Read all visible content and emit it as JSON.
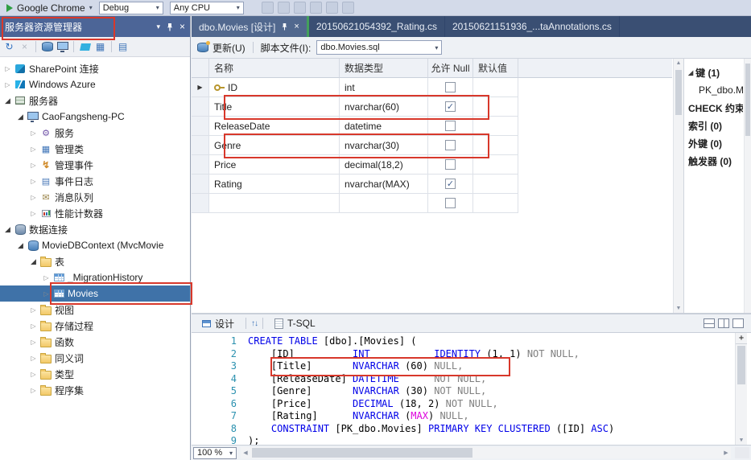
{
  "icons": {
    "play": "▶",
    "dropdown": "▾",
    "close": "×",
    "refresh": "↻",
    "collapsed": "▷",
    "expanded": "◢",
    "check": "✓",
    "swap": "↑↓",
    "scroll_left": "◀",
    "scroll_right": "▶",
    "scroll_up": "▲",
    "scroll_down": "▼",
    "current_row": "▶",
    "splitter_grip": "+"
  },
  "top_toolbar": {
    "run_target": "Google Chrome",
    "configuration": "Debug",
    "platform": "Any CPU"
  },
  "server_explorer": {
    "title": "服务器资源管理器",
    "toolbar_icons": [
      {
        "name": "refresh-icon",
        "type": "glyph",
        "glyph": "↻",
        "color": "#2e6fc0"
      },
      {
        "name": "stop-refresh-icon",
        "type": "glyph",
        "glyph": "×",
        "color": "#b3b8c2"
      },
      {
        "name": "toolbar-separator",
        "type": "sep"
      },
      {
        "name": "connect-to-database-icon",
        "type": "db"
      },
      {
        "name": "connect-to-server-icon",
        "type": "pc"
      },
      {
        "name": "toolbar-separator",
        "type": "sep"
      },
      {
        "name": "connect-to-azure-icon",
        "type": "az"
      },
      {
        "name": "table-view-icon",
        "type": "glyph",
        "glyph": "▦",
        "color": "#3e74b8"
      },
      {
        "name": "toolbar-separator",
        "type": "sep"
      },
      {
        "name": "show-all-files-icon",
        "type": "glyph",
        "glyph": "▤",
        "color": "#3e74b8"
      }
    ],
    "tree": [
      {
        "label": "SharePoint 连接",
        "level": 0,
        "state": "collapsed",
        "icon": "sharepoint"
      },
      {
        "label": "Windows Azure",
        "level": 0,
        "state": "collapsed",
        "icon": "azure"
      },
      {
        "label": "服务器",
        "level": 0,
        "state": "expanded",
        "icon": "servers"
      },
      {
        "label": "CaoFangsheng-PC",
        "level": 1,
        "state": "expanded",
        "icon": "computer"
      },
      {
        "label": "服务",
        "level": 2,
        "state": "collapsed",
        "icon": "services"
      },
      {
        "label": "管理类",
        "level": 2,
        "state": "collapsed",
        "icon": "mgmt-classes"
      },
      {
        "label": "管理事件",
        "level": 2,
        "state": "collapsed",
        "icon": "mgmt-events"
      },
      {
        "label": "事件日志",
        "level": 2,
        "state": "collapsed",
        "icon": "event-logs"
      },
      {
        "label": "消息队列",
        "level": 2,
        "state": "collapsed",
        "icon": "msg-queues"
      },
      {
        "label": "性能计数器",
        "level": 2,
        "state": "collapsed",
        "icon": "perf-counters"
      },
      {
        "label": "数据连接",
        "level": 0,
        "state": "expanded",
        "icon": "data-connections"
      },
      {
        "label": "MovieDBContext (MvcMovie",
        "level": 1,
        "state": "expanded",
        "icon": "database"
      },
      {
        "label": "表",
        "level": 2,
        "state": "expanded",
        "icon": "folder"
      },
      {
        "label": "_MigrationHistory",
        "level": 3,
        "state": "collapsed",
        "icon": "table"
      },
      {
        "label": "Movies",
        "level": 3,
        "state": "collapsed",
        "icon": "table",
        "selected": true
      },
      {
        "label": "视图",
        "level": 2,
        "state": "collapsed",
        "icon": "folder"
      },
      {
        "label": "存储过程",
        "level": 2,
        "state": "collapsed",
        "icon": "folder"
      },
      {
        "label": "函数",
        "level": 2,
        "state": "collapsed",
        "icon": "folder"
      },
      {
        "label": "同义词",
        "level": 2,
        "state": "collapsed",
        "icon": "folder"
      },
      {
        "label": "类型",
        "level": 2,
        "state": "collapsed",
        "icon": "folder"
      },
      {
        "label": "程序集",
        "level": 2,
        "state": "collapsed",
        "icon": "folder"
      }
    ]
  },
  "document_tabs": [
    {
      "label": "dbo.Movies [设计]",
      "active": true
    },
    {
      "label": "20150621054392_Rating.cs",
      "active": false
    },
    {
      "label": "20150621151936_...taAnnotations.cs",
      "active": false
    }
  ],
  "designer_toolbar": {
    "update_label": "更新(U)",
    "script_file_label": "脚本文件(I):",
    "script_file_value": "dbo.Movies.sql"
  },
  "columns_grid": {
    "headers": [
      "名称",
      "数据类型",
      "允许 Null",
      "默认值"
    ],
    "rows": [
      {
        "name": "ID",
        "type": "int",
        "allow_null": false,
        "is_key": true,
        "current": true
      },
      {
        "name": "Title",
        "type": "nvarchar(60)",
        "allow_null": true
      },
      {
        "name": "ReleaseDate",
        "type": "datetime",
        "allow_null": false
      },
      {
        "name": "Genre",
        "type": "nvarchar(30)",
        "allow_null": false
      },
      {
        "name": "Price",
        "type": "decimal(18,2)",
        "allow_null": false
      },
      {
        "name": "Rating",
        "type": "nvarchar(MAX)",
        "allow_null": true
      },
      {
        "name": "",
        "type": "",
        "allow_null": false,
        "is_new": true
      }
    ]
  },
  "context_panel": {
    "items": [
      {
        "label": "键 (1)",
        "bold": true,
        "expander": "expanded",
        "indent": 0
      },
      {
        "label": "PK_dbo.Movies",
        "bold": false,
        "indent": 1
      },
      {
        "label": "CHECK 约束",
        "bold": true,
        "indent": 0
      },
      {
        "label": "索引 (0)",
        "bold": true,
        "indent": 0
      },
      {
        "label": "外键 (0)",
        "bold": true,
        "indent": 0
      },
      {
        "label": "触发器 (0)",
        "bold": true,
        "indent": 0
      }
    ]
  },
  "sql_pane": {
    "design_tab": "设计",
    "tsql_tab": "T-SQL",
    "zoom": "100 %",
    "lines": [
      {
        "num": 1,
        "tokens": [
          [
            "CREATE TABLE",
            "kw"
          ],
          [
            " [dbo].[Movies] (",
            "pl"
          ]
        ]
      },
      {
        "num": 2,
        "tokens": [
          [
            "    [ID]          ",
            "pl"
          ],
          [
            "INT",
            "kw"
          ],
          [
            "           ",
            "pl"
          ],
          [
            "IDENTITY",
            "kw"
          ],
          [
            " (1, 1) ",
            "pl"
          ],
          [
            "NOT NULL,",
            "gr"
          ]
        ]
      },
      {
        "num": 3,
        "tokens": [
          [
            "    [Title]       ",
            "pl"
          ],
          [
            "NVARCHAR",
            "kw"
          ],
          [
            " (60) ",
            "pl"
          ],
          [
            "NULL,",
            "gr"
          ]
        ]
      },
      {
        "num": 4,
        "tokens": [
          [
            "    [ReleaseDate] ",
            "pl"
          ],
          [
            "DATETIME",
            "kw"
          ],
          [
            "      ",
            "pl"
          ],
          [
            "NOT NULL,",
            "gr"
          ]
        ]
      },
      {
        "num": 5,
        "tokens": [
          [
            "    [Genre]       ",
            "pl"
          ],
          [
            "NVARCHAR",
            "kw"
          ],
          [
            " (30) ",
            "pl"
          ],
          [
            "NOT NULL,",
            "gr"
          ]
        ]
      },
      {
        "num": 6,
        "tokens": [
          [
            "    [Price]       ",
            "pl"
          ],
          [
            "DECIMAL",
            "kw"
          ],
          [
            " (18, 2) ",
            "pl"
          ],
          [
            "NOT NULL,",
            "gr"
          ]
        ]
      },
      {
        "num": 7,
        "tokens": [
          [
            "    [Rating]      ",
            "pl"
          ],
          [
            "NVARCHAR",
            "kw"
          ],
          [
            " (",
            "pl"
          ],
          [
            "MAX",
            "mg"
          ],
          [
            ") ",
            "pl"
          ],
          [
            "NULL,",
            "gr"
          ]
        ]
      },
      {
        "num": 8,
        "tokens": [
          [
            "    ",
            "pl"
          ],
          [
            "CONSTRAINT",
            "kw"
          ],
          [
            " [PK_dbo.Movies] ",
            "pl"
          ],
          [
            "PRIMARY KEY CLUSTERED",
            "kw"
          ],
          [
            " ([ID] ",
            "pl"
          ],
          [
            "ASC",
            "kw"
          ],
          [
            ")",
            "pl"
          ]
        ]
      },
      {
        "num": 9,
        "tokens": [
          [
            ");",
            "pl"
          ]
        ]
      }
    ]
  }
}
